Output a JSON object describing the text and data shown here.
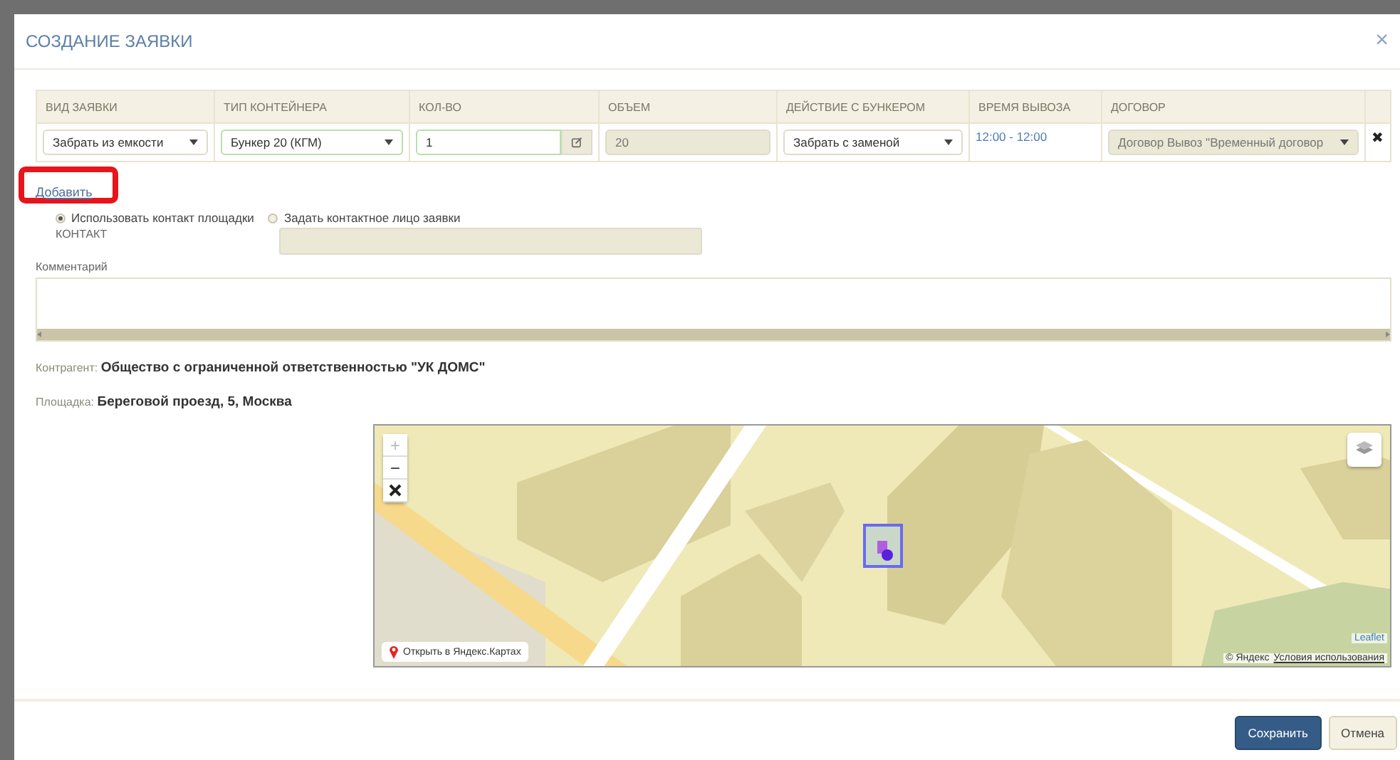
{
  "dialog": {
    "title": "СОЗДАНИЕ ЗАЯВКИ",
    "close": "×"
  },
  "table": {
    "columns": [
      "ВИД ЗАЯВКИ",
      "ТИП КОНТЕЙНЕРА",
      "КОЛ-ВО",
      "ОБЪЕМ",
      "ДЕЙСТВИЕ С БУНКЕРОМ",
      "ВРЕМЯ ВЫВОЗА",
      "ДОГОВОР"
    ],
    "rows": [
      {
        "delete": "✖",
        "cells": [
          {
            "kind": "select",
            "value": "Забрать из емкости",
            "valid": false
          },
          {
            "kind": "select",
            "value": "Бункер 20 (КГМ)",
            "valid": true
          },
          {
            "kind": "input",
            "value": "1",
            "valid": true
          },
          {
            "kind": "readonly",
            "value": "20",
            "valid": false
          },
          {
            "kind": "select",
            "value": "Забрать с заменой",
            "valid": false
          },
          {
            "kind": "link",
            "value": "12:00 - 12:00",
            "valid": false
          },
          {
            "kind": "readonly-select",
            "value": "Договор Вывоз \"Временный договор",
            "valid": false
          }
        ]
      }
    ]
  },
  "add_link": {
    "label": "Добавить",
    "highlighted": true
  },
  "contact_options": [
    {
      "label": "Использовать контакт площадки",
      "selected": true
    },
    {
      "label": "Задать контактное лицо заявки",
      "selected": false
    }
  ],
  "contact": {
    "label": "КОНТАКТ",
    "disabled": true
  },
  "comment": {
    "label": "Комментарий"
  },
  "counterparty": {
    "label": "Контрагент:",
    "value": "Общество с ограниченной ответственностью \"УК ДОМС\""
  },
  "site": {
    "label": "Площадка:",
    "value": "Береговой проезд, 5, Москва"
  },
  "map": {
    "zoom_in": "+",
    "zoom_out": "−",
    "open_link": "Открыть в Яндекс.Картах",
    "leaflet": "Leaflet",
    "copyright": "© Яндекс",
    "terms": "Условия использования"
  },
  "buttons": [
    {
      "label": "Сохранить",
      "kind": "primary"
    },
    {
      "label": "Отмена",
      "kind": "default"
    }
  ]
}
